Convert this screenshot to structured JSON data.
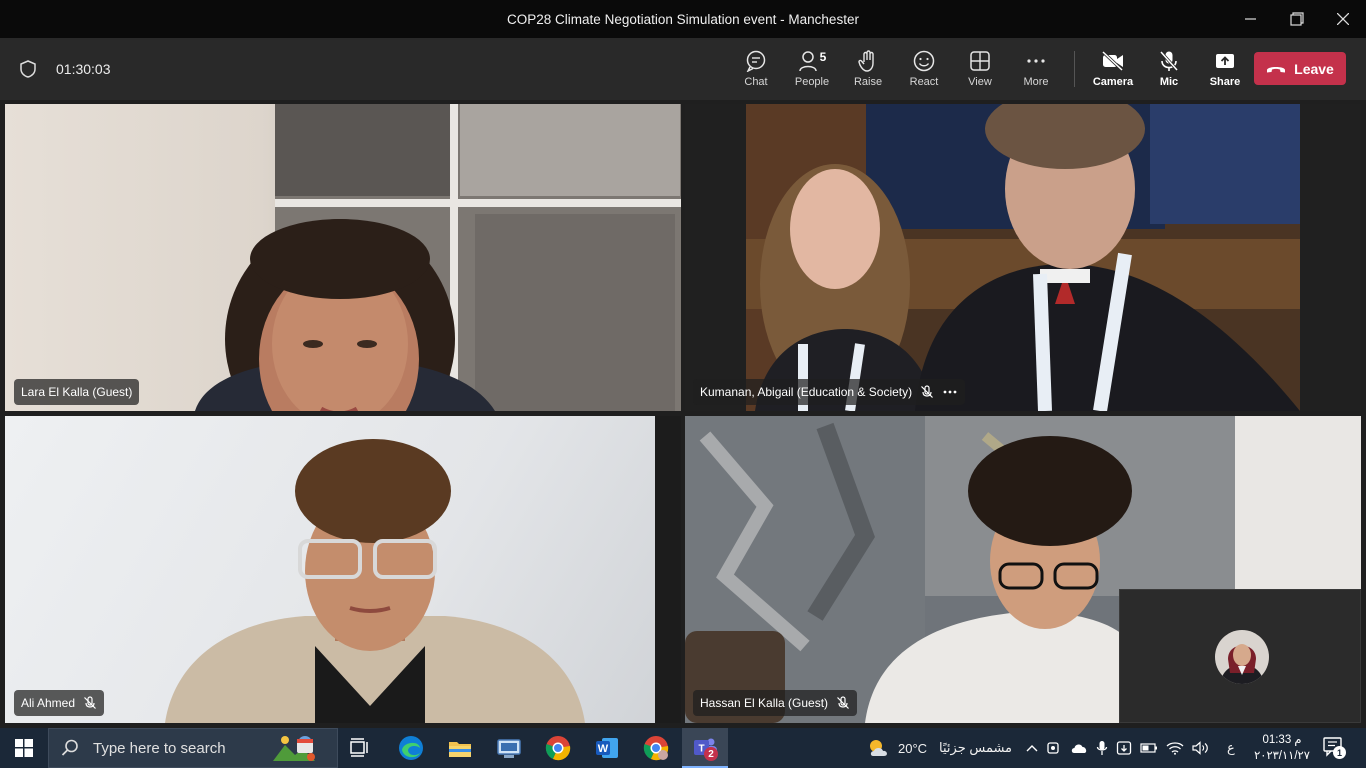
{
  "window": {
    "title": "COP28 Climate Negotiation Simulation event - Manchester"
  },
  "meeting": {
    "duration": "01:30:03"
  },
  "toolbar": {
    "chat": "Chat",
    "people": "People",
    "people_count": "5",
    "raise": "Raise",
    "react": "React",
    "view": "View",
    "more": "More",
    "camera": "Camera",
    "mic": "Mic",
    "share": "Share",
    "leave": "Leave"
  },
  "participants": [
    {
      "name": "Lara El Kalla (Guest)",
      "muted": false
    },
    {
      "name": "Kumanan, Abigail (Education & Society)",
      "muted": true
    },
    {
      "name": "Ali Ahmed",
      "muted": true
    },
    {
      "name": "Hassan El Kalla (Guest)",
      "muted": true
    }
  ],
  "taskbar": {
    "search_placeholder": "Type here to search",
    "teams_badge": "2",
    "weather_temp": "20°C",
    "weather_desc": "مشمس جزئيًا",
    "language": "ع",
    "time": "01:33 م",
    "date": "٢٠٢٣/١١/٢٧",
    "notification_count": "1"
  },
  "colors": {
    "leave_button": "#c4314b",
    "toolbar_bg": "#292929",
    "taskbar_bg": "#1b2838"
  }
}
